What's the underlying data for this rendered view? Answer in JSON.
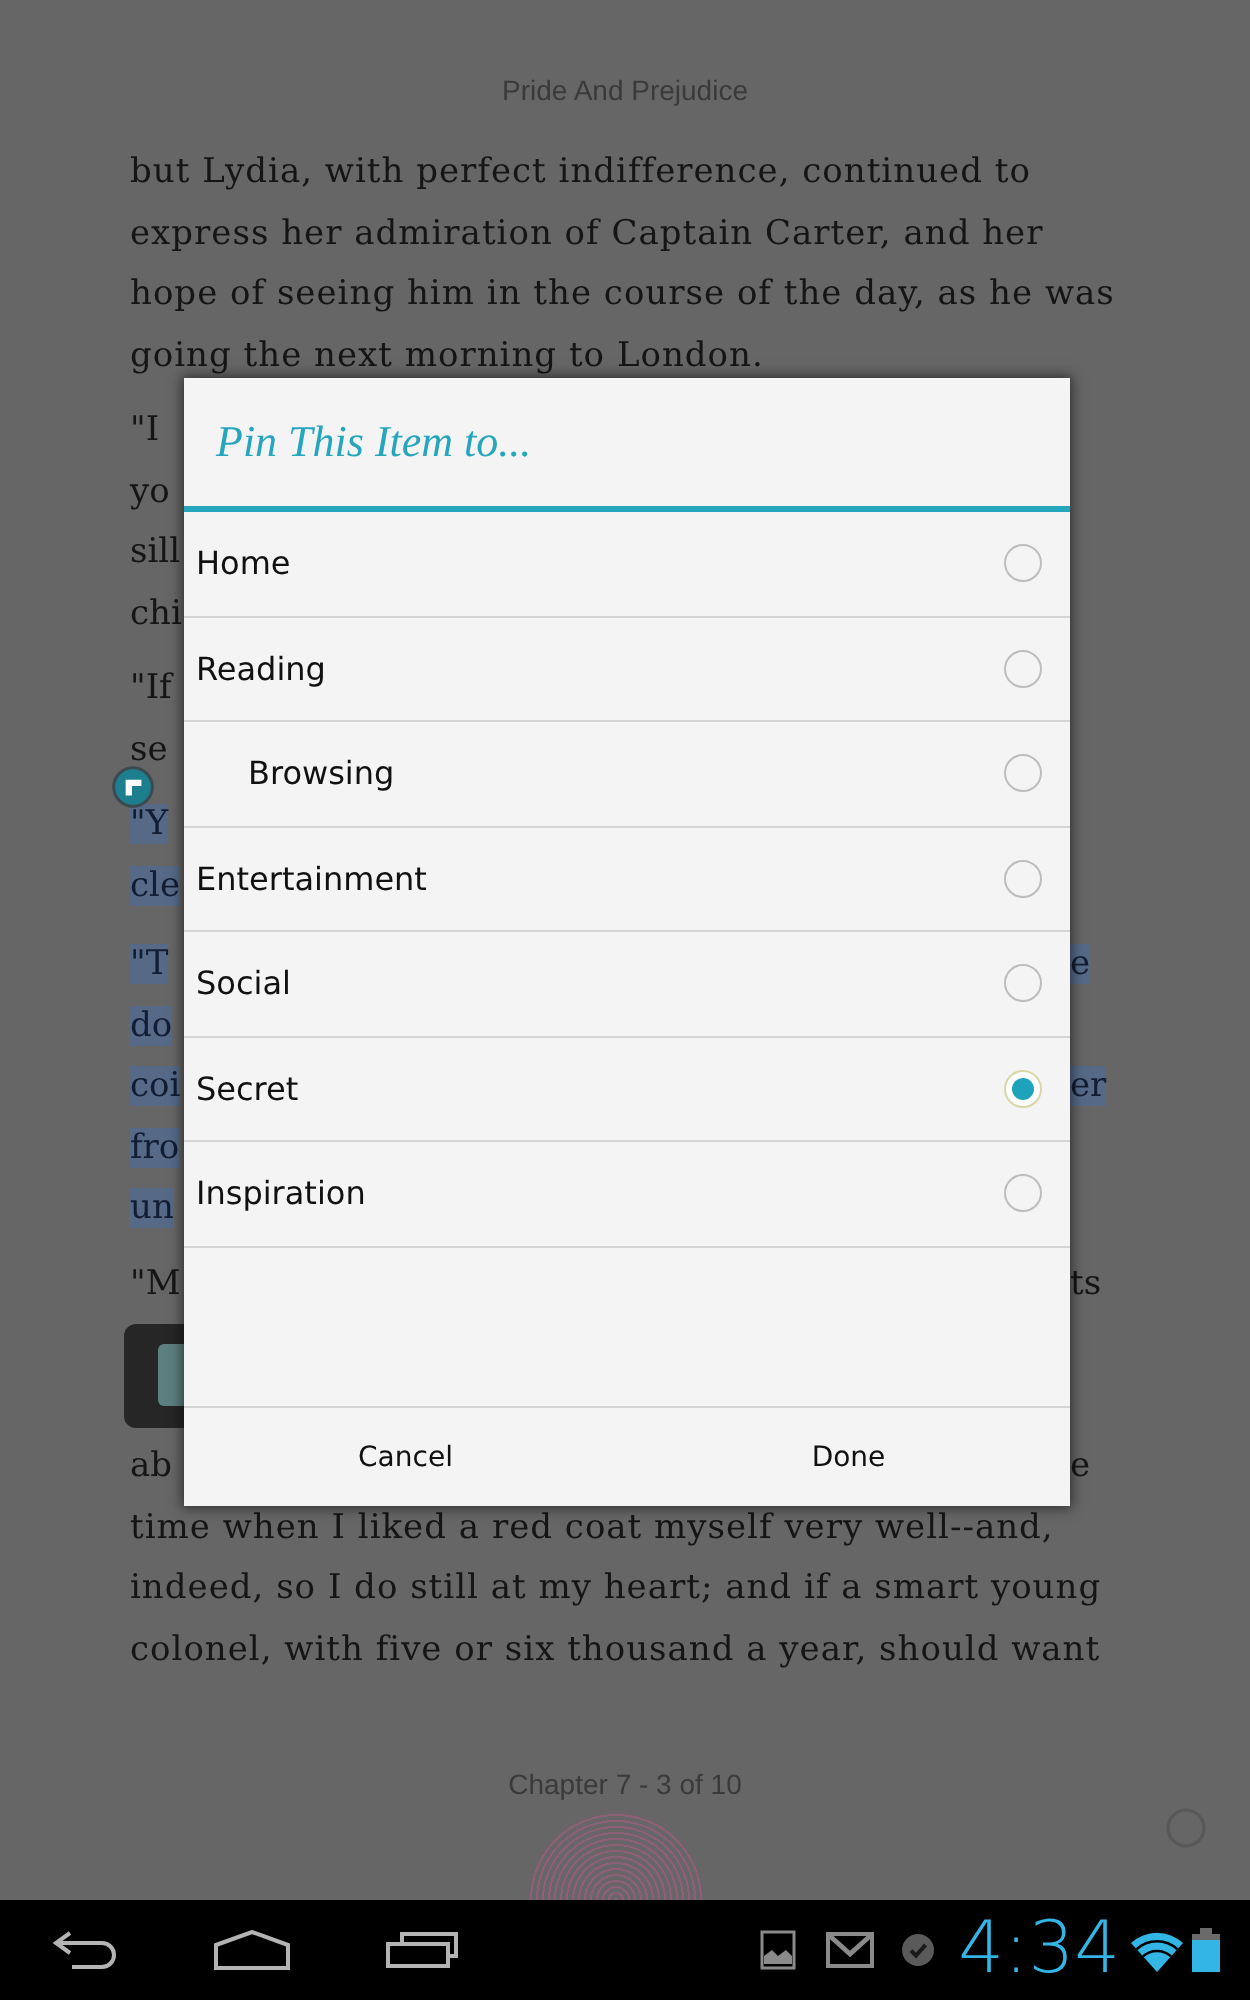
{
  "book": {
    "title": "Pride And Prejudice"
  },
  "page": {
    "blocks": [
      {
        "lines": [
          {
            "kind": "text",
            "text": "but Lydia, with perfect indifference, continued to",
            "highlighted": false
          },
          {
            "kind": "text",
            "text": "express her admiration of Captain Carter, and her",
            "highlighted": false
          },
          {
            "kind": "text",
            "text": "hope of seeing him in the course of the day, as he was",
            "highlighted": false
          },
          {
            "kind": "text",
            "text": "going the next morning to London.",
            "highlighted": false
          }
        ]
      },
      {
        "lines": [
          {
            "kind": "clipped",
            "left": {
              "text": "\"I",
              "highlighted": false
            }
          },
          {
            "kind": "clipped",
            "left": {
              "text": "yo",
              "highlighted": false
            }
          },
          {
            "kind": "clipped",
            "left": {
              "text": "sill",
              "highlighted": false
            }
          },
          {
            "kind": "clipped",
            "left": {
              "text": "chi",
              "highlighted": false
            }
          }
        ]
      },
      {
        "lines": [
          {
            "kind": "clipped",
            "left": {
              "text": "\"If",
              "highlighted": false
            }
          },
          {
            "kind": "clipped",
            "left": {
              "text": "se",
              "highlighted": false
            }
          }
        ]
      },
      {
        "lines": [
          {
            "kind": "clipped",
            "left": {
              "text": "\"Y",
              "highlighted": true
            }
          },
          {
            "kind": "clipped",
            "left": {
              "text": "cle",
              "highlighted": true
            }
          }
        ]
      },
      {
        "lines": [
          {
            "kind": "clipped",
            "left": {
              "text": "\"T",
              "highlighted": true
            },
            "right": {
              "text": "e",
              "highlighted": true
            }
          },
          {
            "kind": "clipped",
            "left": {
              "text": "do",
              "highlighted": true
            }
          },
          {
            "kind": "clipped",
            "left": {
              "text": "coi",
              "highlighted": true
            },
            "right": {
              "text": "er",
              "highlighted": true
            }
          },
          {
            "kind": "clipped",
            "left": {
              "text": "fro",
              "highlighted": true
            }
          },
          {
            "kind": "clipped",
            "left": {
              "text": "un",
              "highlighted": true
            }
          }
        ]
      },
      {
        "lines": [
          {
            "kind": "clipped",
            "left": {
              "text": "\"M",
              "highlighted": false
            },
            "right": {
              "text": "ts",
              "highlighted": false
            }
          },
          {
            "kind": "popup"
          },
          {
            "kind": "clipped",
            "left": {
              "text": "ab",
              "highlighted": false
            },
            "right": {
              "text": "e",
              "highlighted": false
            }
          },
          {
            "kind": "text",
            "text": "time when I liked a red coat myself very well--and,",
            "highlighted": false
          },
          {
            "kind": "text",
            "text": "indeed, so I do still at my heart; and if a smart young",
            "highlighted": false
          },
          {
            "kind": "text",
            "text": "colonel, with five or six thousand a year, should want",
            "highlighted": false
          }
        ]
      }
    ]
  },
  "dialog": {
    "title": "Pin This Item to...",
    "options": [
      {
        "label": "Home",
        "selected": false
      },
      {
        "label": "Reading",
        "selected": false,
        "children": [
          {
            "label": "Browsing",
            "selected": false
          }
        ]
      },
      {
        "label": "Entertainment",
        "selected": false
      },
      {
        "label": "Social",
        "selected": false
      },
      {
        "label": "Secret",
        "selected": true
      },
      {
        "label": "Inspiration",
        "selected": false
      }
    ],
    "buttons": [
      "Cancel",
      "Done"
    ]
  },
  "footer": {
    "chapter_label": "Chapter 7 - 3 of 10"
  },
  "status_bar": {
    "time": "4:34"
  }
}
